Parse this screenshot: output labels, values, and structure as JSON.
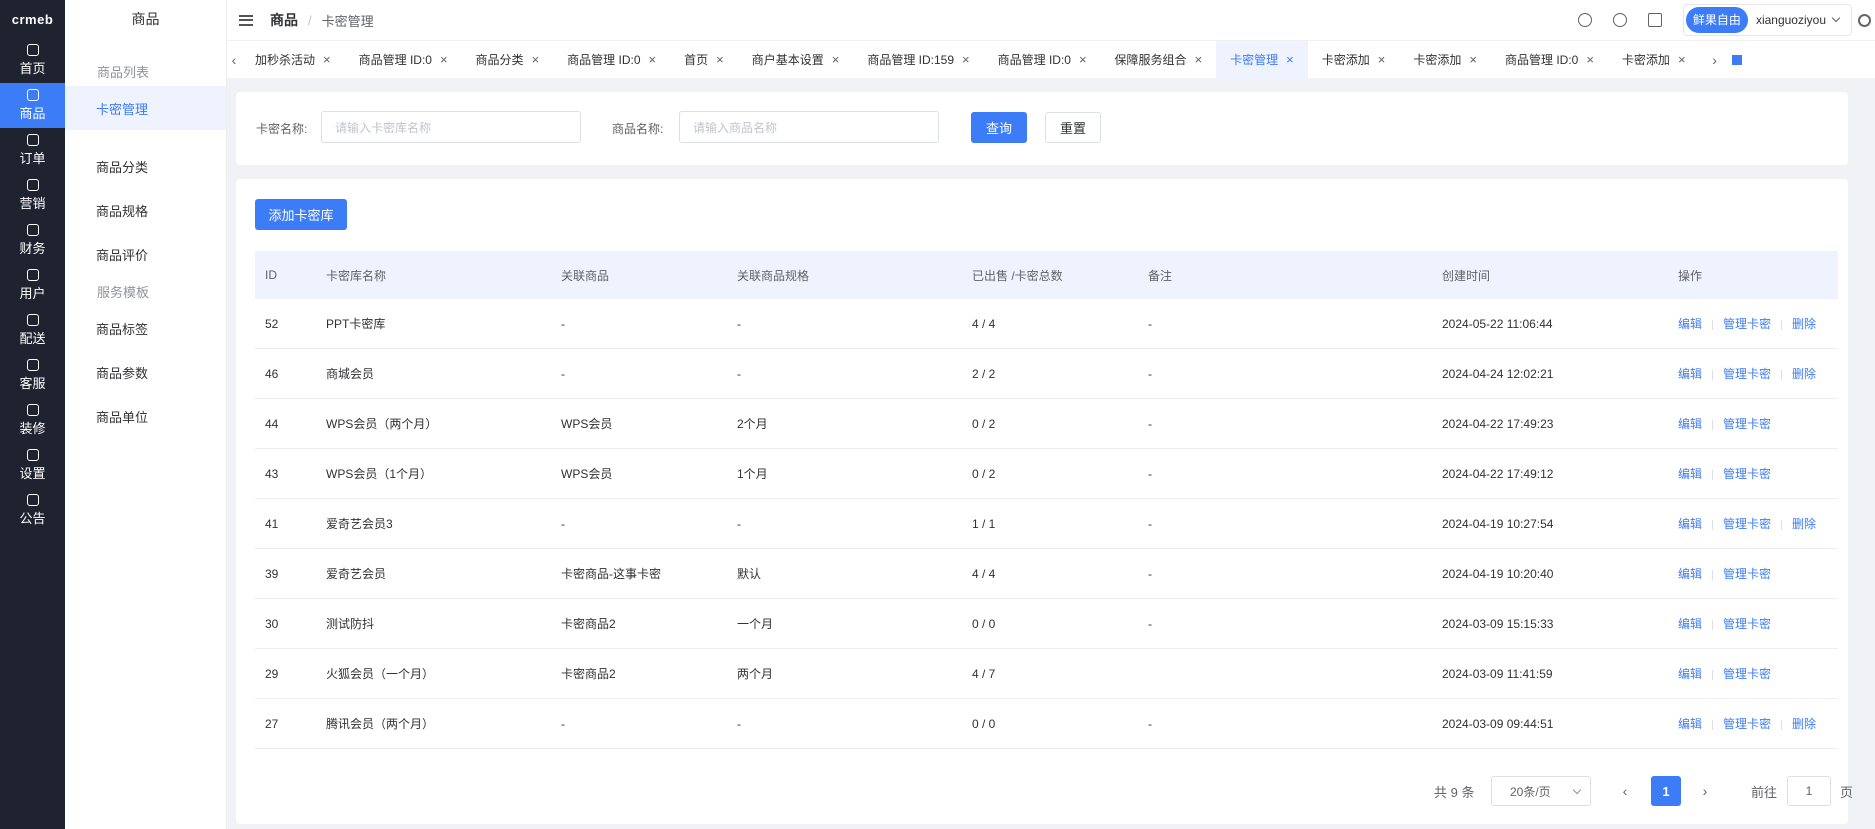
{
  "rail": {
    "logo": "crmeb",
    "items": [
      {
        "label": "首页"
      },
      {
        "label": "商品"
      },
      {
        "label": "订单"
      },
      {
        "label": "营销"
      },
      {
        "label": "财务"
      },
      {
        "label": "用户"
      },
      {
        "label": "配送"
      },
      {
        "label": "客服"
      },
      {
        "label": "装修"
      },
      {
        "label": "设置"
      },
      {
        "label": "公告"
      }
    ]
  },
  "submenu": {
    "title": "商品",
    "group1": "商品列表",
    "items1": [
      {
        "label": "卡密管理"
      },
      {
        "label": "商品分类"
      },
      {
        "label": "商品规格"
      },
      {
        "label": "商品评价"
      }
    ],
    "group2": "服务模板",
    "items2": [
      {
        "label": "商品标签"
      },
      {
        "label": "商品参数"
      },
      {
        "label": "商品单位"
      }
    ]
  },
  "header": {
    "breadcrumb_1": "商品",
    "breadcrumb_sep": "/",
    "breadcrumb_2": "卡密管理",
    "brand": "鲜果自由",
    "username": "xianguoziyou"
  },
  "tabs": [
    {
      "label": "加秒杀活动"
    },
    {
      "label": "商品管理 ID:0"
    },
    {
      "label": "商品分类"
    },
    {
      "label": "商品管理 ID:0"
    },
    {
      "label": "首页"
    },
    {
      "label": "商户基本设置"
    },
    {
      "label": "商品管理 ID:159"
    },
    {
      "label": "商品管理 ID:0"
    },
    {
      "label": "保障服务组合"
    },
    {
      "label": "卡密管理"
    },
    {
      "label": "卡密添加"
    },
    {
      "label": "卡密添加"
    },
    {
      "label": "商品管理 ID:0"
    },
    {
      "label": "卡密添加"
    }
  ],
  "search": {
    "card_label": "卡密名称:",
    "card_placeholder": "请输入卡密库名称",
    "product_label": "商品名称:",
    "product_placeholder": "请输入商品名称",
    "query": "查询",
    "reset": "重置"
  },
  "main": {
    "add_button": "添加卡密库",
    "columns": {
      "id": "ID",
      "name": "卡密库名称",
      "product": "关联商品",
      "spec": "关联商品规格",
      "sold": "已出售 /卡密总数",
      "note": "备注",
      "time": "创建时间",
      "ops": "操作"
    },
    "op_edit": "编辑",
    "op_manage": "管理卡密",
    "op_delete": "删除",
    "rows": [
      {
        "id": "52",
        "name": "PPT卡密库",
        "product": "-",
        "spec": "-",
        "sold": "4 / 4",
        "note": "-",
        "time": "2024-05-22 11:06:44"
      },
      {
        "id": "46",
        "name": "商城会员",
        "product": "-",
        "spec": "-",
        "sold": "2 / 2",
        "note": "-",
        "time": "2024-04-24 12:02:21"
      },
      {
        "id": "44",
        "name": "WPS会员（两个月）",
        "product": "WPS会员",
        "spec": "2个月",
        "sold": "0 / 2",
        "note": "-",
        "time": "2024-04-22 17:49:23"
      },
      {
        "id": "43",
        "name": "WPS会员（1个月）",
        "product": "WPS会员",
        "spec": "1个月",
        "sold": "0 / 2",
        "note": "-",
        "time": "2024-04-22 17:49:12"
      },
      {
        "id": "41",
        "name": "爱奇艺会员3",
        "product": "-",
        "spec": "-",
        "sold": "1 / 1",
        "note": "-",
        "time": "2024-04-19 10:27:54"
      },
      {
        "id": "39",
        "name": "爱奇艺会员",
        "product": "卡密商品-这事卡密",
        "spec": "默认",
        "sold": "4 / 4",
        "note": "-",
        "time": "2024-04-19 10:20:40"
      },
      {
        "id": "30",
        "name": "测试防抖",
        "product": "卡密商品2",
        "spec": "一个月",
        "sold": "0 / 0",
        "note": "-",
        "time": "2024-03-09 15:15:33"
      },
      {
        "id": "29",
        "name": "火狐会员（一个月）",
        "product": "卡密商品2",
        "spec": "两个月",
        "sold": "4 / 7",
        "note": "",
        "time": "2024-03-09 11:41:59"
      },
      {
        "id": "27",
        "name": "腾讯会员（两个月）",
        "product": "-",
        "spec": "-",
        "sold": "0 / 0",
        "note": "-",
        "time": "2024-03-09 09:44:51"
      }
    ]
  },
  "pagination": {
    "total": "共 9 条",
    "page_size": "20条/页",
    "current": "1",
    "goto_prefix": "前往",
    "goto_value": "1",
    "goto_suffix": "页"
  }
}
